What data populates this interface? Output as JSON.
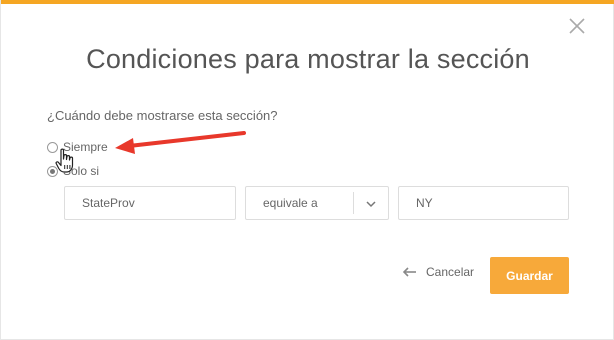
{
  "dialog": {
    "title": "Condiciones para mostrar la sección",
    "question": "¿Cuándo debe mostrarse esta sección?",
    "options": [
      {
        "label": "Siempre",
        "selected": false
      },
      {
        "label": "Solo si",
        "selected": true
      }
    ],
    "condition": {
      "field": "StateProv",
      "operator": "equivale a",
      "value": "NY"
    },
    "cancel_label": "Cancelar",
    "save_label": "Guardar",
    "close_icon": "close-icon"
  },
  "colors": {
    "accent": "#f5a623",
    "save_button": "#f7a93a",
    "annotation_arrow": "#e8382b"
  }
}
